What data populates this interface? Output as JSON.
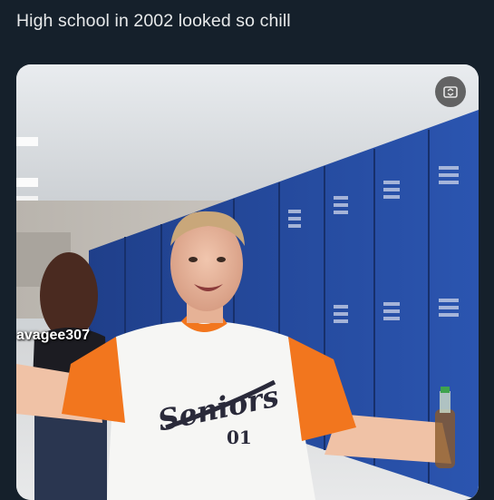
{
  "post": {
    "text": "High school in 2002 looked so chill"
  },
  "media": {
    "overlay_icon": "camera-flip-icon",
    "watermark": "avagee307",
    "shirt_text": "Seniors",
    "shirt_number": "01"
  },
  "colors": {
    "background": "#15202b",
    "text": "#e7e9ea",
    "locker_blue": "#2b55b0",
    "sleeve_orange": "#f2761e"
  }
}
